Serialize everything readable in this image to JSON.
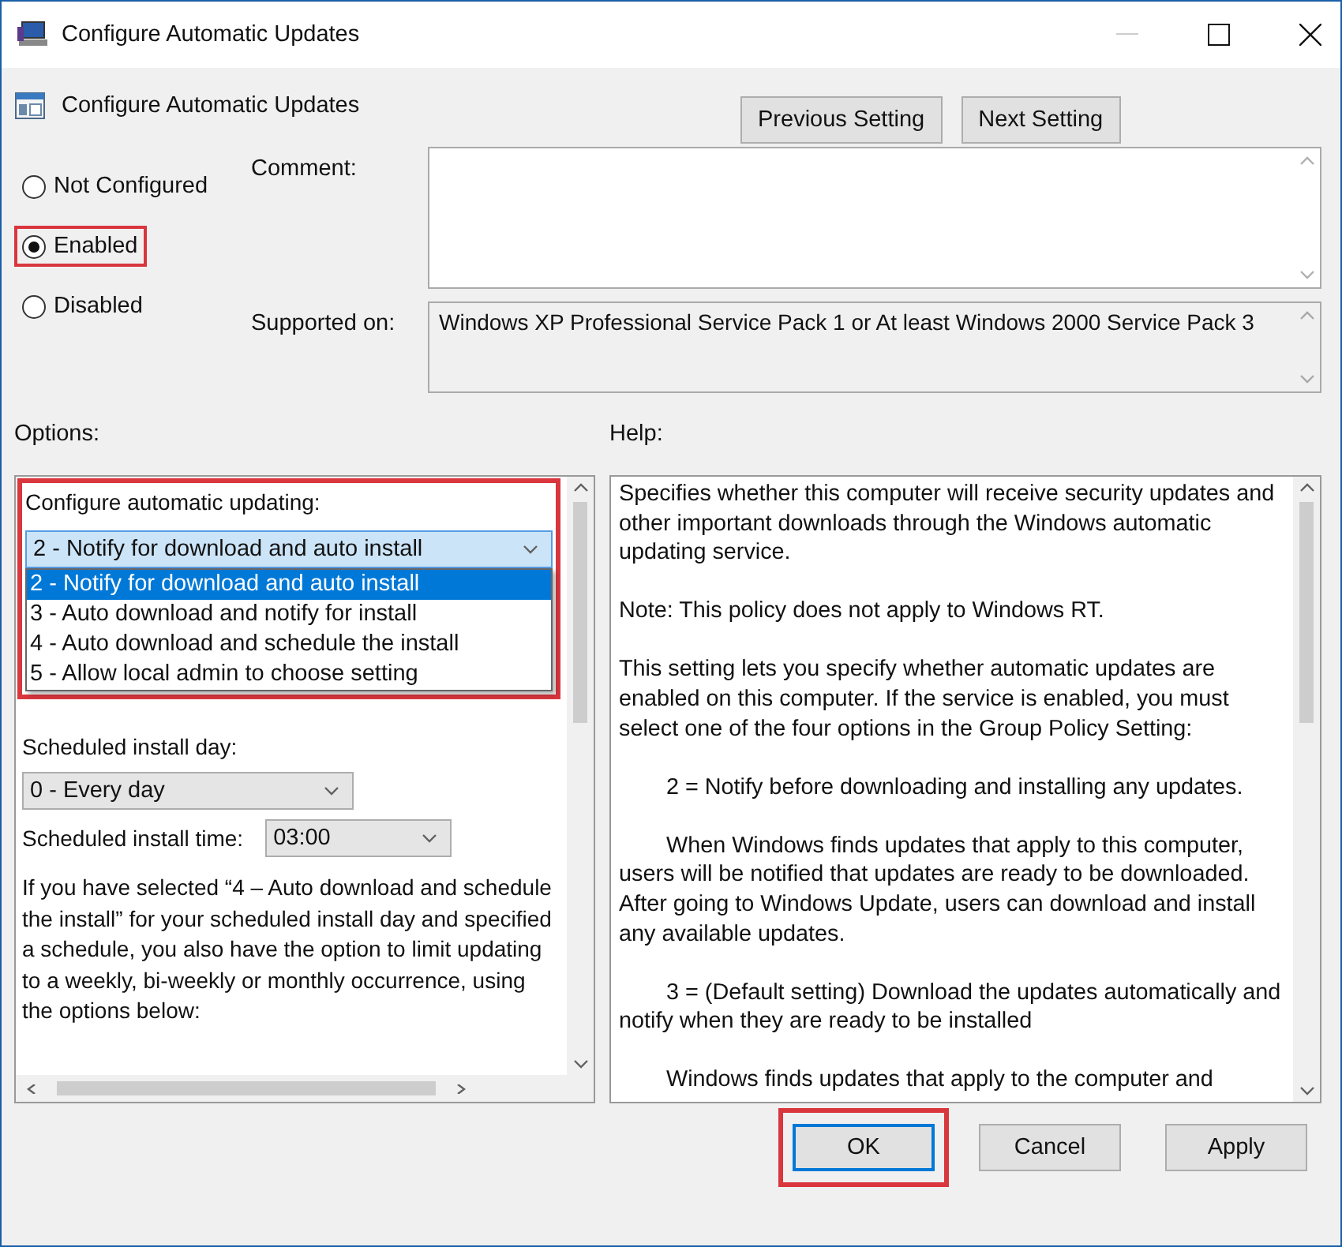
{
  "window": {
    "title": "Configure Automatic Updates"
  },
  "header": {
    "title": "Configure Automatic Updates",
    "buttons": [
      {
        "label": "Previous Setting"
      },
      {
        "label": "Next Setting"
      }
    ]
  },
  "state_options": [
    {
      "label": "Not Configured",
      "selected": false,
      "highlighted": false
    },
    {
      "label": "Enabled",
      "selected": true,
      "highlighted": true
    },
    {
      "label": "Disabled",
      "selected": false,
      "highlighted": false
    }
  ],
  "comment": {
    "label": "Comment:"
  },
  "supported_on": {
    "label": "Supported on:",
    "value": "Windows XP Professional Service Pack 1 or At least Windows 2000 Service Pack 3"
  },
  "options": {
    "label": "Options:",
    "update_mode": {
      "label": "Configure automatic updating:",
      "value": "2 - Notify for download and auto install",
      "expanded": true,
      "highlighted": true,
      "choices": [
        {
          "label": "2 - Notify for download and auto install",
          "selected": true
        },
        {
          "label": "3 - Auto download and notify for install",
          "selected": false
        },
        {
          "label": "4 - Auto download and schedule the install",
          "selected": false
        },
        {
          "label": "5 - Allow local admin to choose setting",
          "selected": false
        }
      ]
    },
    "install_day": {
      "label": "Scheduled install day:",
      "value": "0 - Every day"
    },
    "install_time": {
      "label": "Scheduled install time:",
      "value": "03:00"
    },
    "note": "If you have selected “4 – Auto download and schedule the install” for your scheduled install day and specified a schedule, you also have the option to limit updating to a weekly, bi-weekly or monthly occurrence, using the options below:"
  },
  "help": {
    "label": "Help:",
    "paragraphs": [
      {
        "text": "Specifies whether this computer will receive security updates and other important downloads through the Windows automatic updating service.",
        "indented": false
      },
      {
        "text": "Note: This policy does not apply to Windows RT.",
        "indented": false
      },
      {
        "text": "This setting lets you specify whether automatic updates are enabled on this computer. If the service is enabled, you must select one of the four options in the Group Policy Setting:",
        "indented": false
      },
      {
        "text": "2 = Notify before downloading and installing any updates.",
        "indented": true
      },
      {
        "text": "When Windows finds updates that apply to this computer, users will be notified that updates are ready to be downloaded. After going to Windows Update, users can download and install any available updates.",
        "indented": true
      },
      {
        "text": "3 = (Default setting) Download the updates automatically and notify when they are ready to be installed",
        "indented": true
      },
      {
        "text": "Windows finds updates that apply to the computer and",
        "indented": true
      }
    ]
  },
  "footer_buttons": [
    {
      "label": "OK",
      "default": true,
      "highlighted": true
    },
    {
      "label": "Cancel",
      "default": false,
      "highlighted": false
    },
    {
      "label": "Apply",
      "default": false,
      "highlighted": false
    }
  ]
}
